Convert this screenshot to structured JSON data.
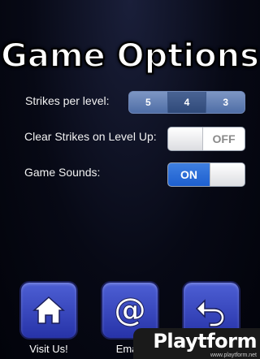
{
  "title": "Game Options",
  "strikes": {
    "label": "Strikes per level:",
    "options": [
      "5",
      "4",
      "3"
    ],
    "selected": "4"
  },
  "clear_strikes": {
    "label": "Clear Strikes on Level Up:",
    "state": "OFF"
  },
  "game_sounds": {
    "label": "Game Sounds:",
    "state": "ON"
  },
  "nav": {
    "visit": {
      "label": "Visit Us!",
      "icon": "home-icon"
    },
    "email": {
      "label": "Email",
      "icon": "at-sign-icon"
    },
    "back": {
      "label": "",
      "icon": "back-arrow-icon"
    }
  },
  "watermark": {
    "logo": "Playtform",
    "url": "www.playtform.net"
  },
  "colors": {
    "segment_blue": "#5d7bb3",
    "toggle_on": "#2a6bd6",
    "nav_button": "#3a48c4"
  }
}
